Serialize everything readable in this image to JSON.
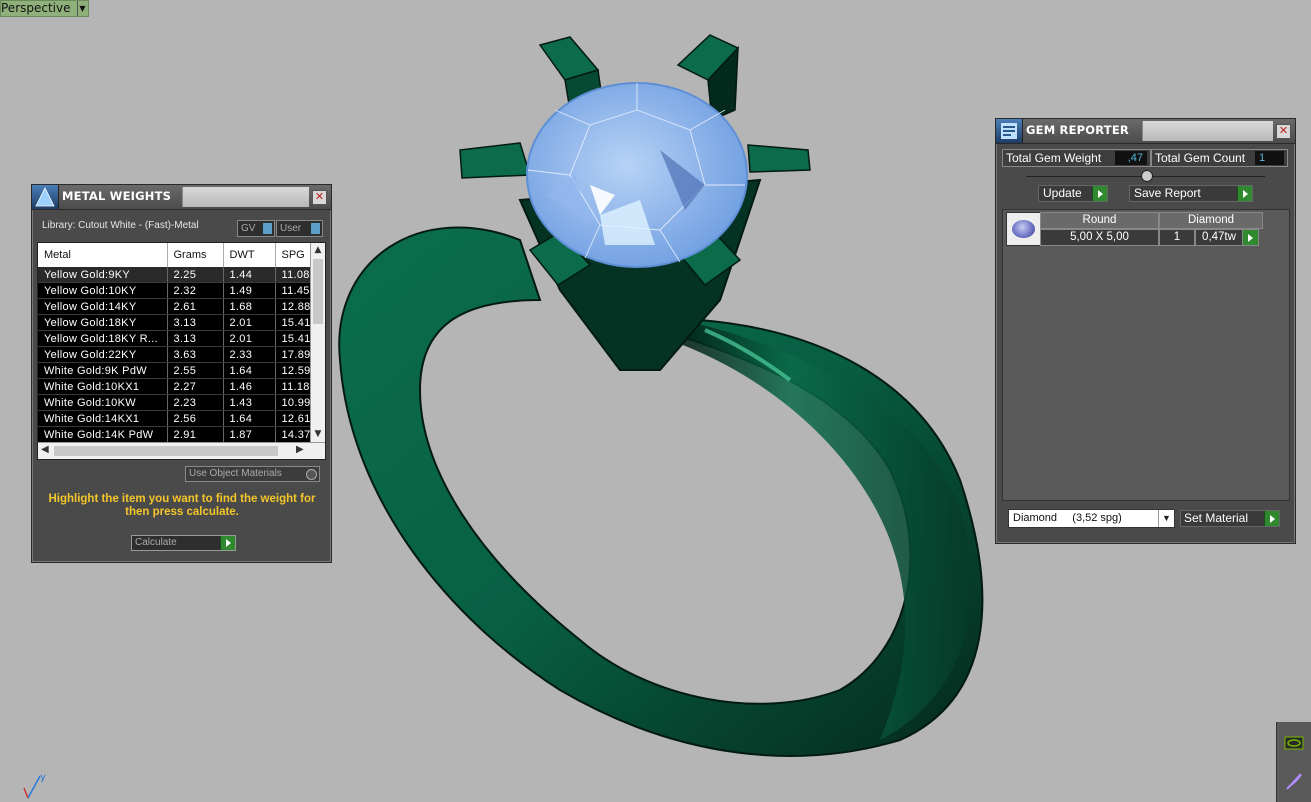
{
  "viewport": {
    "label": "Perspective"
  },
  "metal_weights": {
    "title": "METAL WEIGHTS",
    "library": "Library: Cutout White - (Fast)-Metal",
    "toggle_gv": "GV",
    "toggle_user": "User",
    "columns": [
      "Metal",
      "Grams",
      "DWT",
      "SPG"
    ],
    "rows": [
      [
        "Yellow Gold:9KY",
        "2.25",
        "1.44",
        "11.08"
      ],
      [
        "Yellow Gold:10KY",
        "2.32",
        "1.49",
        "11.45"
      ],
      [
        "Yellow Gold:14KY",
        "2.61",
        "1.68",
        "12.88"
      ],
      [
        "Yellow Gold:18KY",
        "3.13",
        "2.01",
        "15.41"
      ],
      [
        "Yellow Gold:18KY R...",
        "3.13",
        "2.01",
        "15.41"
      ],
      [
        "Yellow Gold:22KY",
        "3.63",
        "2.33",
        "17.89"
      ],
      [
        "White Gold:9K PdW",
        "2.55",
        "1.64",
        "12.59"
      ],
      [
        "White Gold:10KX1",
        "2.27",
        "1.46",
        "11.18"
      ],
      [
        "White Gold:10KW",
        "2.23",
        "1.43",
        "10.99"
      ],
      [
        "White Gold:14KX1",
        "2.56",
        "1.64",
        "12.61"
      ],
      [
        "White Gold:14K PdW",
        "2.91",
        "1.87",
        "14.37"
      ]
    ],
    "use_object_materials": "Use Object Materials",
    "hint": "Highlight the item you want to find the weight for then press calculate.",
    "calculate": "Calculate"
  },
  "gem_reporter": {
    "title": "GEM REPORTER",
    "total_weight_label": "Total Gem Weight",
    "total_weight_value": ",47",
    "total_count_label": "Total Gem Count",
    "total_count_value": "1",
    "update": "Update",
    "save_report": "Save Report",
    "headers": {
      "shape": "Round",
      "material": "Diamond"
    },
    "row": {
      "size": "5,00 X 5,00",
      "count": "1",
      "weight": "0,47tw"
    },
    "material_select": "Diamond     (3,52 spg)",
    "set_material": "Set Material"
  },
  "colors": {
    "ring": "#0a6a4a",
    "gem": "#7aa8e8",
    "panel": "#4a4a4a",
    "accent_text": "#f3c62a"
  },
  "icons": [
    "chevron-down-icon",
    "close-icon",
    "play-icon",
    "gem-icon",
    "axis-gizmo-icon",
    "nvidia-icon",
    "feather-icon"
  ]
}
